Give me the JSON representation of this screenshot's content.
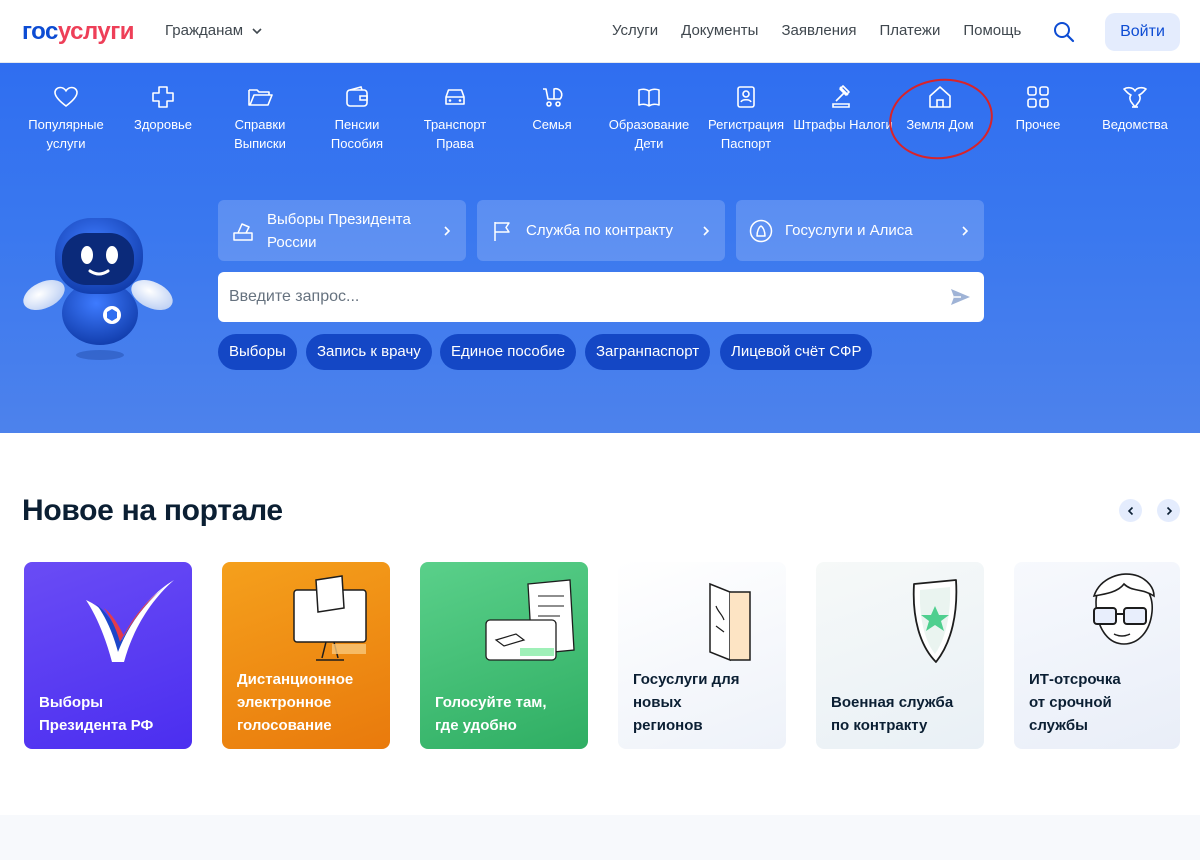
{
  "header": {
    "logo_part1": "гос",
    "logo_part2": "услуги",
    "audience": "Гражданам",
    "nav": [
      "Услуги",
      "Документы",
      "Заявления",
      "Платежи",
      "Помощь"
    ],
    "login": "Войти"
  },
  "categories": [
    {
      "label": "Популярные услуги",
      "icon": "heart-icon"
    },
    {
      "label": "Здоровье",
      "icon": "cross-icon"
    },
    {
      "label": "Справки Выписки",
      "icon": "folder-icon"
    },
    {
      "label": "Пенсии Пособия",
      "icon": "wallet-icon"
    },
    {
      "label": "Транспорт Права",
      "icon": "car-icon"
    },
    {
      "label": "Семья",
      "icon": "stroller-icon"
    },
    {
      "label": "Образование Дети",
      "icon": "book-icon"
    },
    {
      "label": "Регистрация Паспорт",
      "icon": "passport-icon"
    },
    {
      "label": "Штрафы Налоги",
      "icon": "gavel-icon"
    },
    {
      "label": "Земля Дом",
      "icon": "house-icon"
    },
    {
      "label": "Прочее",
      "icon": "grid-icon"
    },
    {
      "label": "Ведомства",
      "icon": "eagle-icon"
    }
  ],
  "promos": [
    {
      "label": "Выборы Президента России",
      "icon": "ballot-icon"
    },
    {
      "label": "Служба по контракту",
      "icon": "flag-icon"
    },
    {
      "label": "Госуслуги и Алиса",
      "icon": "alice-icon"
    }
  ],
  "search": {
    "placeholder": "Введите запрос..."
  },
  "chips": [
    "Выборы",
    "Запись к врачу",
    "Единое пособие",
    "Загранпаспорт",
    "Лицевой счёт СФР"
  ],
  "section": {
    "title": "Новое на портале"
  },
  "cards": [
    {
      "title": "Выборы Президента РФ",
      "bg": "#5b3df0"
    },
    {
      "title": "Дистанционное электронное голосование",
      "bg": "#f08a12"
    },
    {
      "title": "Голосуйте там, где удобно",
      "bg": "#3fbf73"
    },
    {
      "title": "Госуслуги для новых регионов",
      "bg": "#f4f6fb"
    },
    {
      "title": "Военная служба по контракту",
      "bg": "#eef3f7"
    },
    {
      "title": "ИТ-отсрочка от срочной службы",
      "bg": "#eef2fa"
    }
  ],
  "colors": {
    "brand_blue": "#0d4cd3",
    "brand_red": "#ee3f58",
    "hero_blue": "#3a78ef",
    "chip_blue": "#1447c5",
    "highlight_red": "#d8232a"
  }
}
